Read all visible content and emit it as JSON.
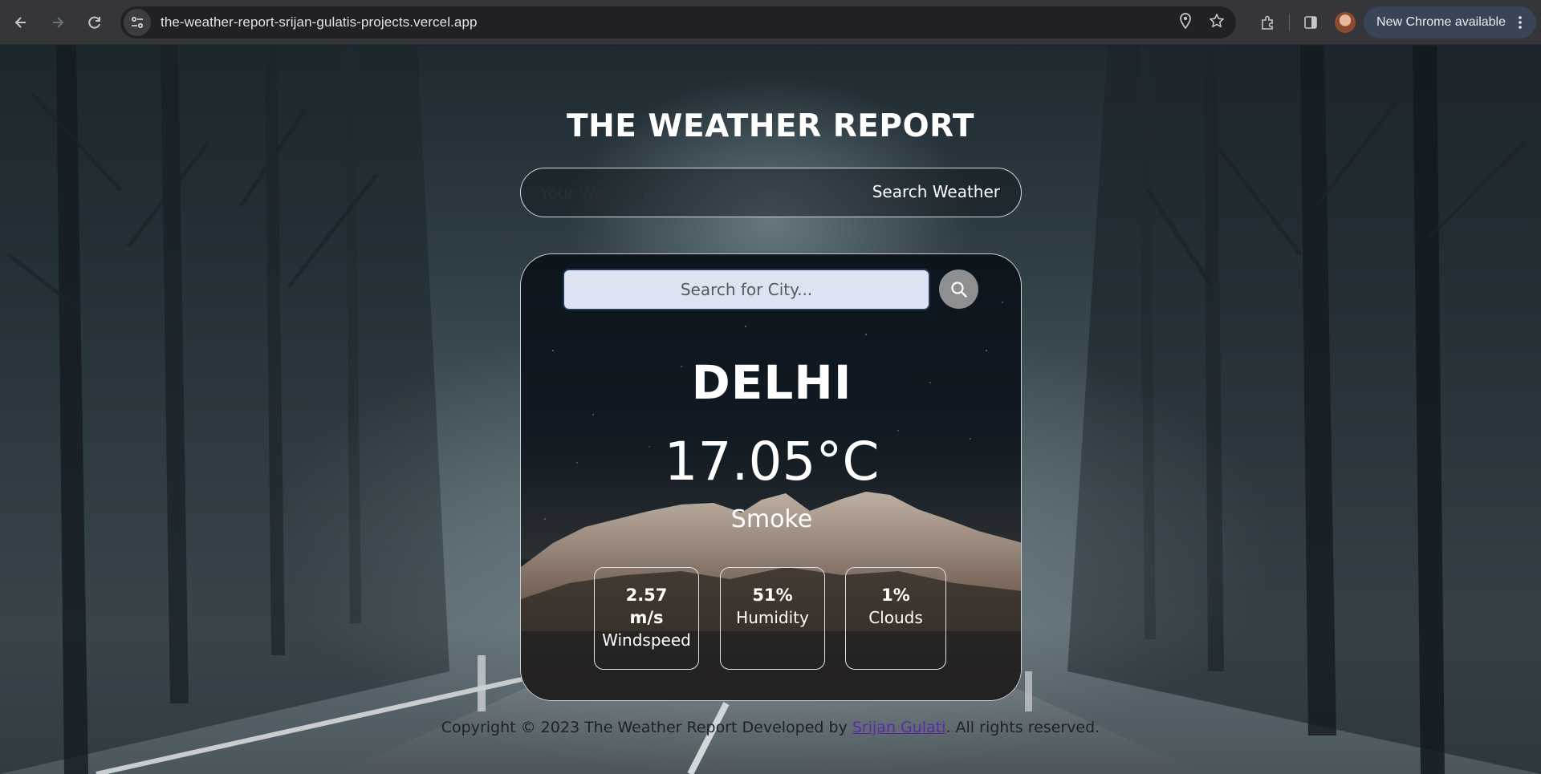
{
  "browser": {
    "url": "the-weather-report-srijan-gulatis-projects.vercel.app",
    "update_label": "New Chrome available",
    "icons": [
      "back-icon",
      "forward-icon",
      "reload-icon",
      "site-settings-icon",
      "location-icon",
      "bookmark-star-icon",
      "extensions-icon",
      "side-panel-icon",
      "profile-avatar",
      "kebab-menu-icon"
    ]
  },
  "header": {
    "title": "THE WEATHER REPORT",
    "search_placeholder": "Your Weather",
    "search_button": "Search Weather"
  },
  "card": {
    "city_placeholder": "Search for City...",
    "city": "DELHI",
    "temperature": "17.05°C",
    "condition": "Smoke",
    "stats": [
      {
        "value_line1": "2.57",
        "value_line2": "m/s",
        "label": "Windspeed"
      },
      {
        "value_line1": "51%",
        "label": "Humidity"
      },
      {
        "value_line1": "1%",
        "label": "Clouds"
      }
    ]
  },
  "footer": {
    "prefix": "Copyright © 2023 The Weather Report Developed by ",
    "author_link": "Srijan Gulati",
    "suffix": ". All rights reserved."
  },
  "colors": {
    "chrome_bg": "#35363a",
    "omnibox_bg": "#202124",
    "update_pill_bg": "#394457",
    "city_input_bg": "#dde3f0",
    "link": "#5b2aa6"
  }
}
